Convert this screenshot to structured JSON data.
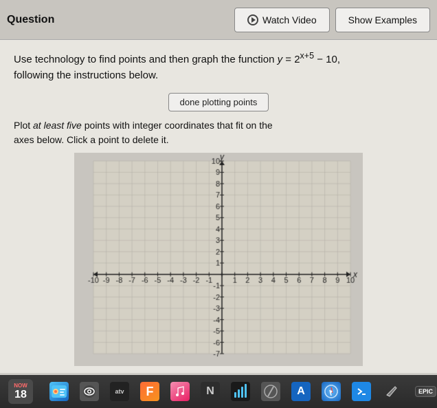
{
  "header": {
    "title": "Question",
    "watch_label": "Watch Video",
    "examples_label": "Show Examples"
  },
  "question": {
    "text_line1": "Use technology to find points and then graph the function ",
    "equation": "y = 2",
    "exponent": "x+5",
    "text_line2": " − 10,",
    "text_line3": "following the instructions below.",
    "done_button": "done plotting points",
    "instruction_line1": "Plot ",
    "instruction_em": "at least five",
    "instruction_line2": " points with integer coordinates that fit on the",
    "instruction_line3": "axes below. Click a point to delete it."
  },
  "graph": {
    "x_min": -10,
    "x_max": 10,
    "y_min": -7,
    "y_max": 10,
    "axis_label_x": "x",
    "axis_label_y": "y"
  },
  "taskbar": {
    "date_month": "now",
    "date_day": "18",
    "items": [
      {
        "name": "finder",
        "label": ""
      },
      {
        "name": "eye",
        "label": ""
      },
      {
        "name": "atv",
        "label": "atv"
      },
      {
        "name": "fortnite",
        "label": "F"
      },
      {
        "name": "music",
        "label": "♪"
      },
      {
        "name": "notion",
        "label": "N"
      },
      {
        "name": "files",
        "label": "📁"
      },
      {
        "name": "signal",
        "label": "📶"
      },
      {
        "name": "slash",
        "label": "/"
      },
      {
        "name": "a-icon",
        "label": "A"
      },
      {
        "name": "safari",
        "label": ""
      },
      {
        "name": "xcode",
        "label": ""
      },
      {
        "name": "edit",
        "label": "✎"
      },
      {
        "name": "epic",
        "label": "EPIC"
      }
    ]
  }
}
